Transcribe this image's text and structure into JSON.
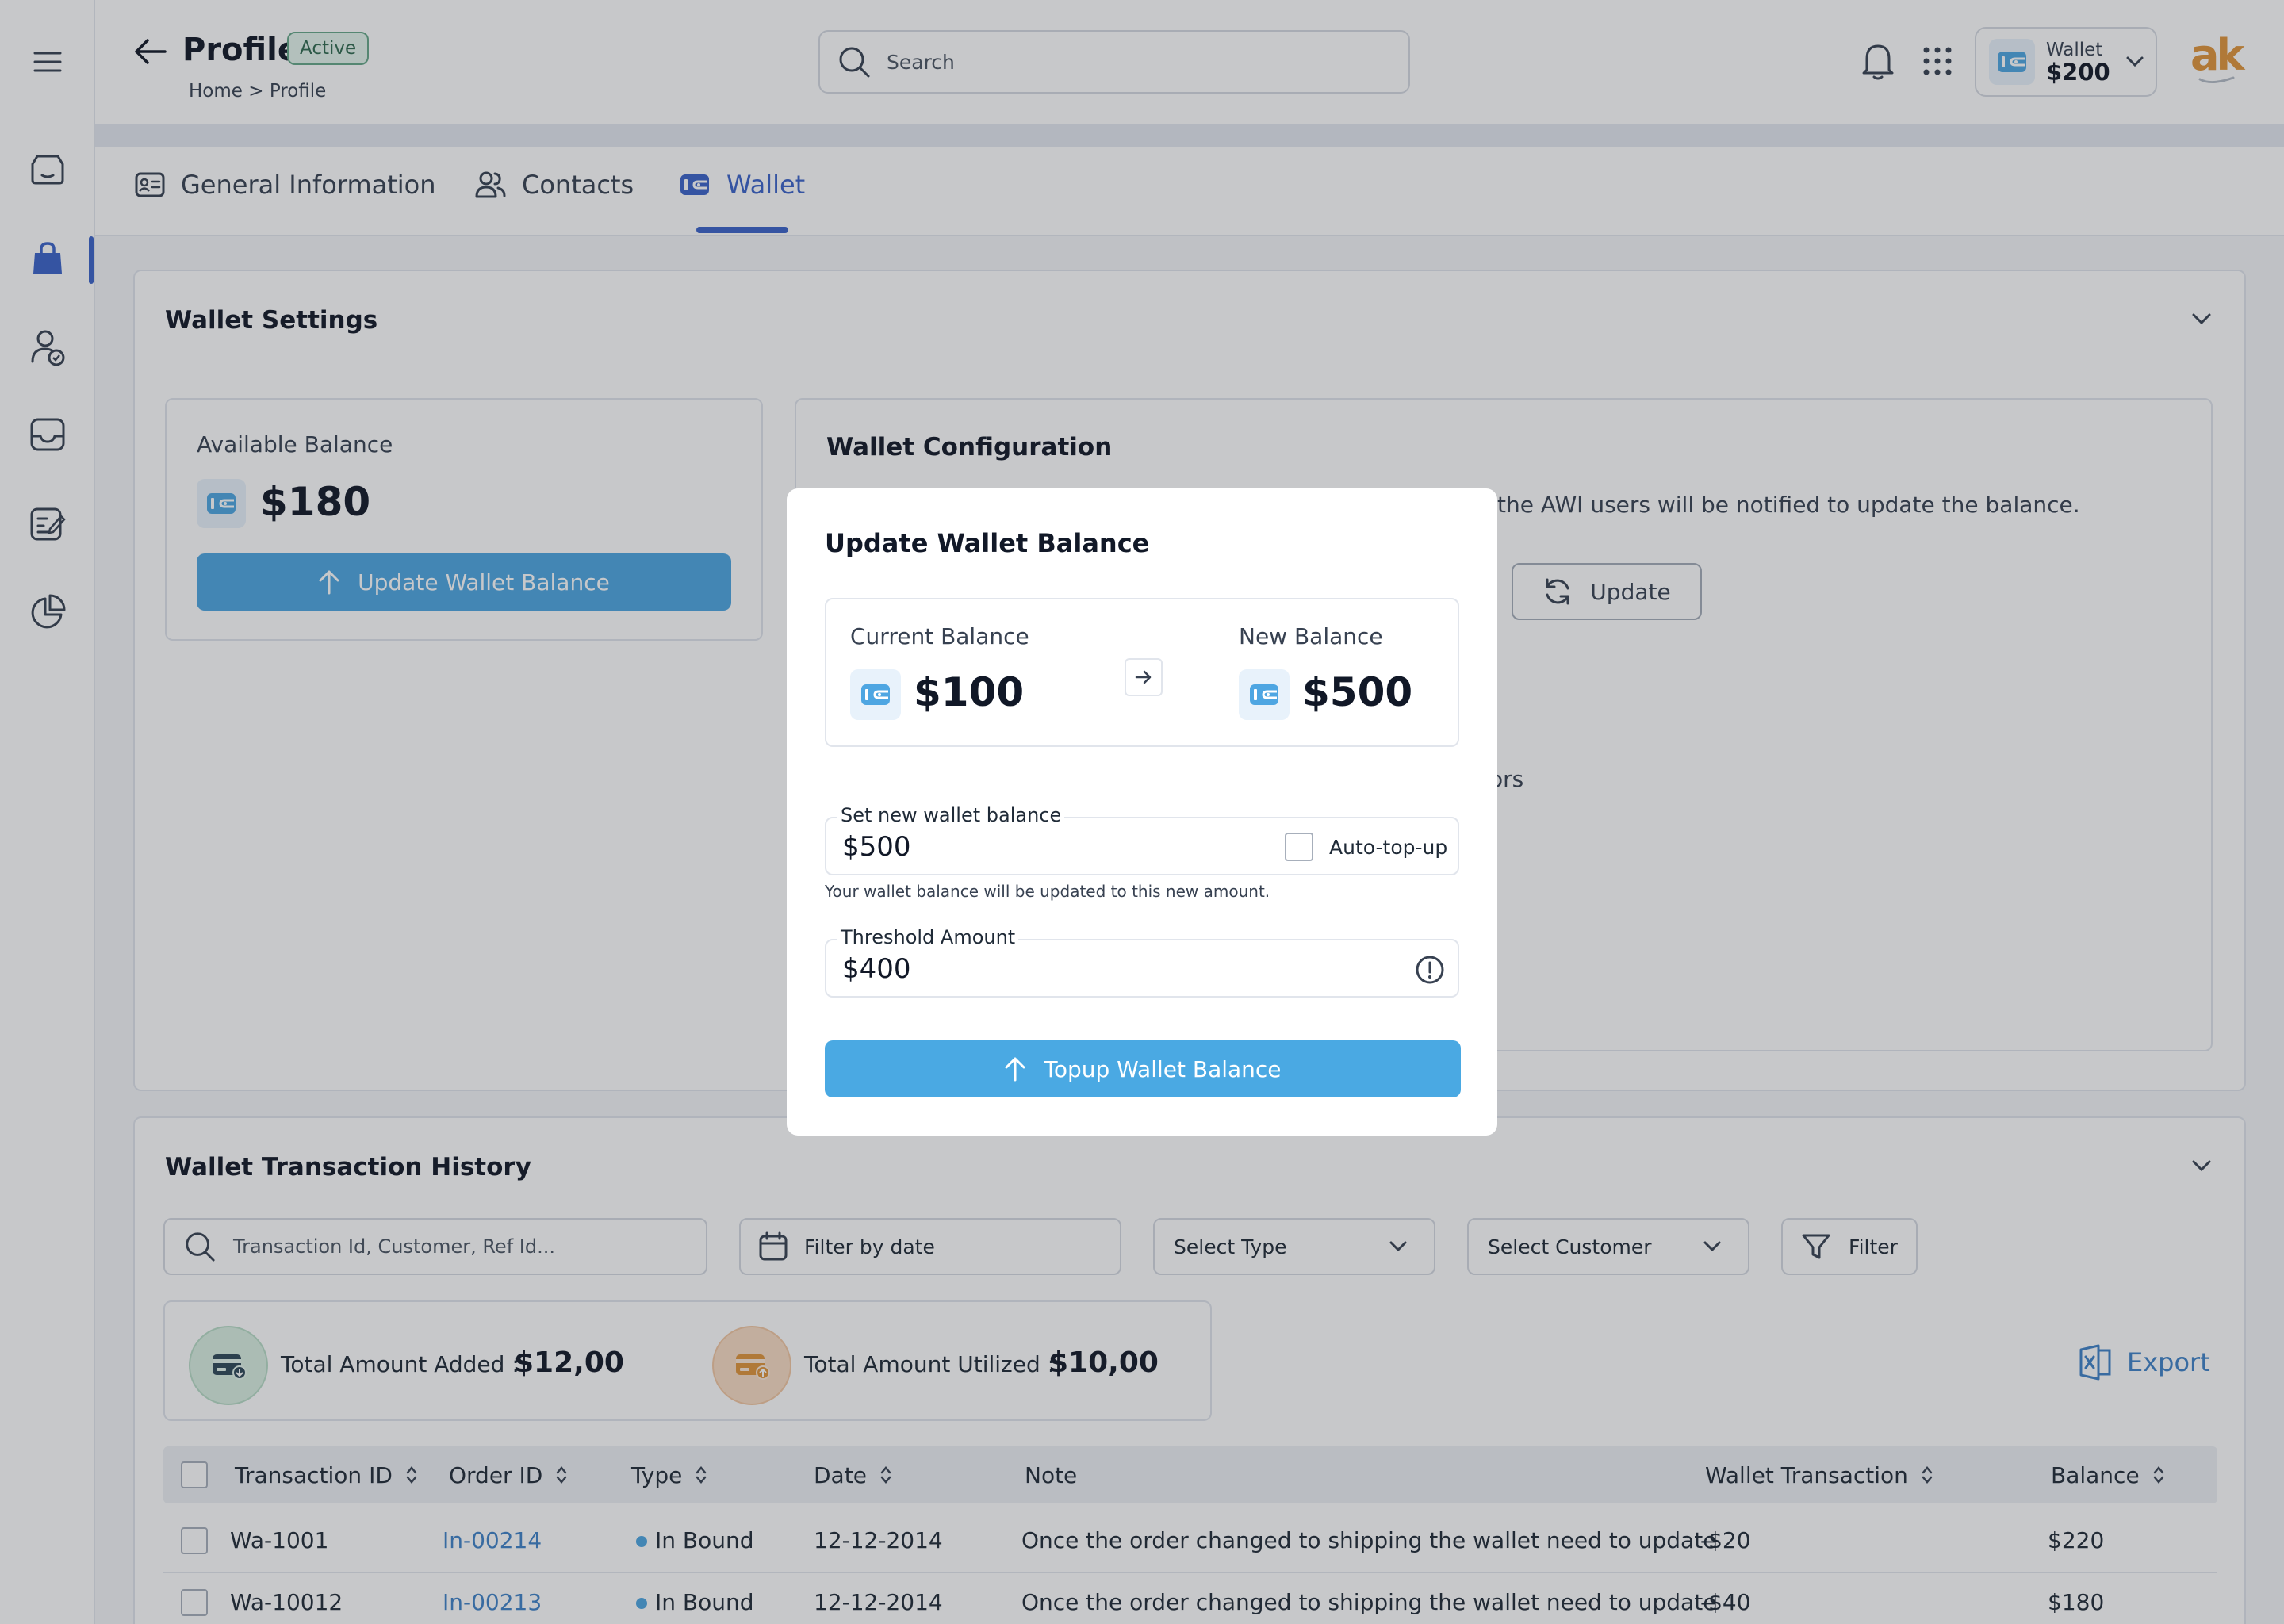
{
  "header": {
    "title": "Profile",
    "status_badge": "Active",
    "breadcrumb": "Home > Profile",
    "search_placeholder": "Search",
    "wallet_label": "Wallet",
    "wallet_amount": "$200",
    "logo_text": "ak"
  },
  "tabs": [
    {
      "label": "General Information"
    },
    {
      "label": "Contacts"
    },
    {
      "label": "Wallet"
    }
  ],
  "wallet_settings": {
    "title": "Wallet Settings",
    "available_balance_label": "Available Balance",
    "available_balance_value": "$180",
    "update_button": "Update Wallet Balance"
  },
  "wallet_configuration": {
    "title": "Wallet Configuration",
    "visible_text_1": "the AWI users will be notified to update the balance.",
    "update_button": "Update",
    "visible_text_2": "ors"
  },
  "transaction_history": {
    "title": "Wallet Transaction History",
    "search_placeholder": "Transaction Id, Customer, Ref Id...",
    "filter_date": "Filter by date",
    "select_type": "Select Type",
    "select_customer": "Select Customer",
    "filter_button": "Filter",
    "total_added_label": "Total Amount Added :",
    "total_added_value": "$12,00",
    "total_utilized_label": "Total Amount Utilized :",
    "total_utilized_value": "$10,00",
    "export_button": "Export",
    "columns": [
      "Transaction ID",
      "Order ID",
      "Type",
      "Date",
      "Note",
      "Wallet Transaction",
      "Balance"
    ],
    "rows": [
      {
        "id": "Wa-1001",
        "order": "In-00214",
        "type": "In Bound",
        "date": "12-12-2014",
        "note": "Once the order changed to shipping the wallet need to update",
        "txn": "-$20",
        "balance": "$220"
      },
      {
        "id": "Wa-10012",
        "order": "In-00213",
        "type": "In Bound",
        "date": "12-12-2014",
        "note": "Once the order changed to shipping the wallet need to update",
        "txn": "-$40",
        "balance": "$180"
      }
    ]
  },
  "modal": {
    "title": "Update Wallet Balance",
    "current_label": "Current Balance",
    "current_value": "$100",
    "new_label": "New Balance",
    "new_value": "$500",
    "set_label": "Set new wallet balance",
    "set_value": "$500",
    "auto_topup": "Auto-top-up",
    "helper": "Your wallet balance will be updated to this new amount.",
    "threshold_label": "Threshold Amount",
    "threshold_value": "$400",
    "topup_button": "Topup Wallet Balance"
  },
  "colors": {
    "primary": "#3b63c9",
    "accent_blue": "#4ea6e2",
    "success": "#66a889",
    "warning": "#e0a060"
  }
}
